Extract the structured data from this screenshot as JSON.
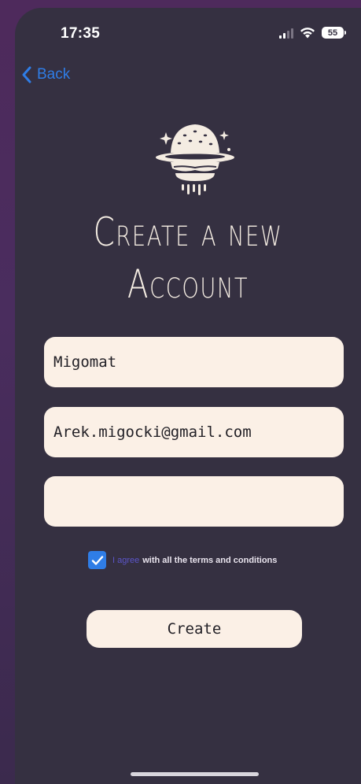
{
  "status_bar": {
    "time": "17:35",
    "battery": "55"
  },
  "nav": {
    "back_label": "Back"
  },
  "header": {
    "title_line1": "Create a new",
    "title_line2": "Account"
  },
  "form": {
    "username_value": "Migomat",
    "email_value": "Arek.migocki@gmail.com",
    "password_value": "",
    "agree_checked": true,
    "agree_link": "I agree",
    "agree_rest": "with all the terms and conditions",
    "create_label": "Create"
  },
  "colors": {
    "background": "#353041",
    "field_bg": "#fbf0e6",
    "accent_blue": "#2f7de6",
    "link_purple": "#5b55c9"
  },
  "icons": {
    "logo": "burger-logo-icon",
    "back": "chevron-left-icon",
    "check": "checkmark-icon"
  }
}
